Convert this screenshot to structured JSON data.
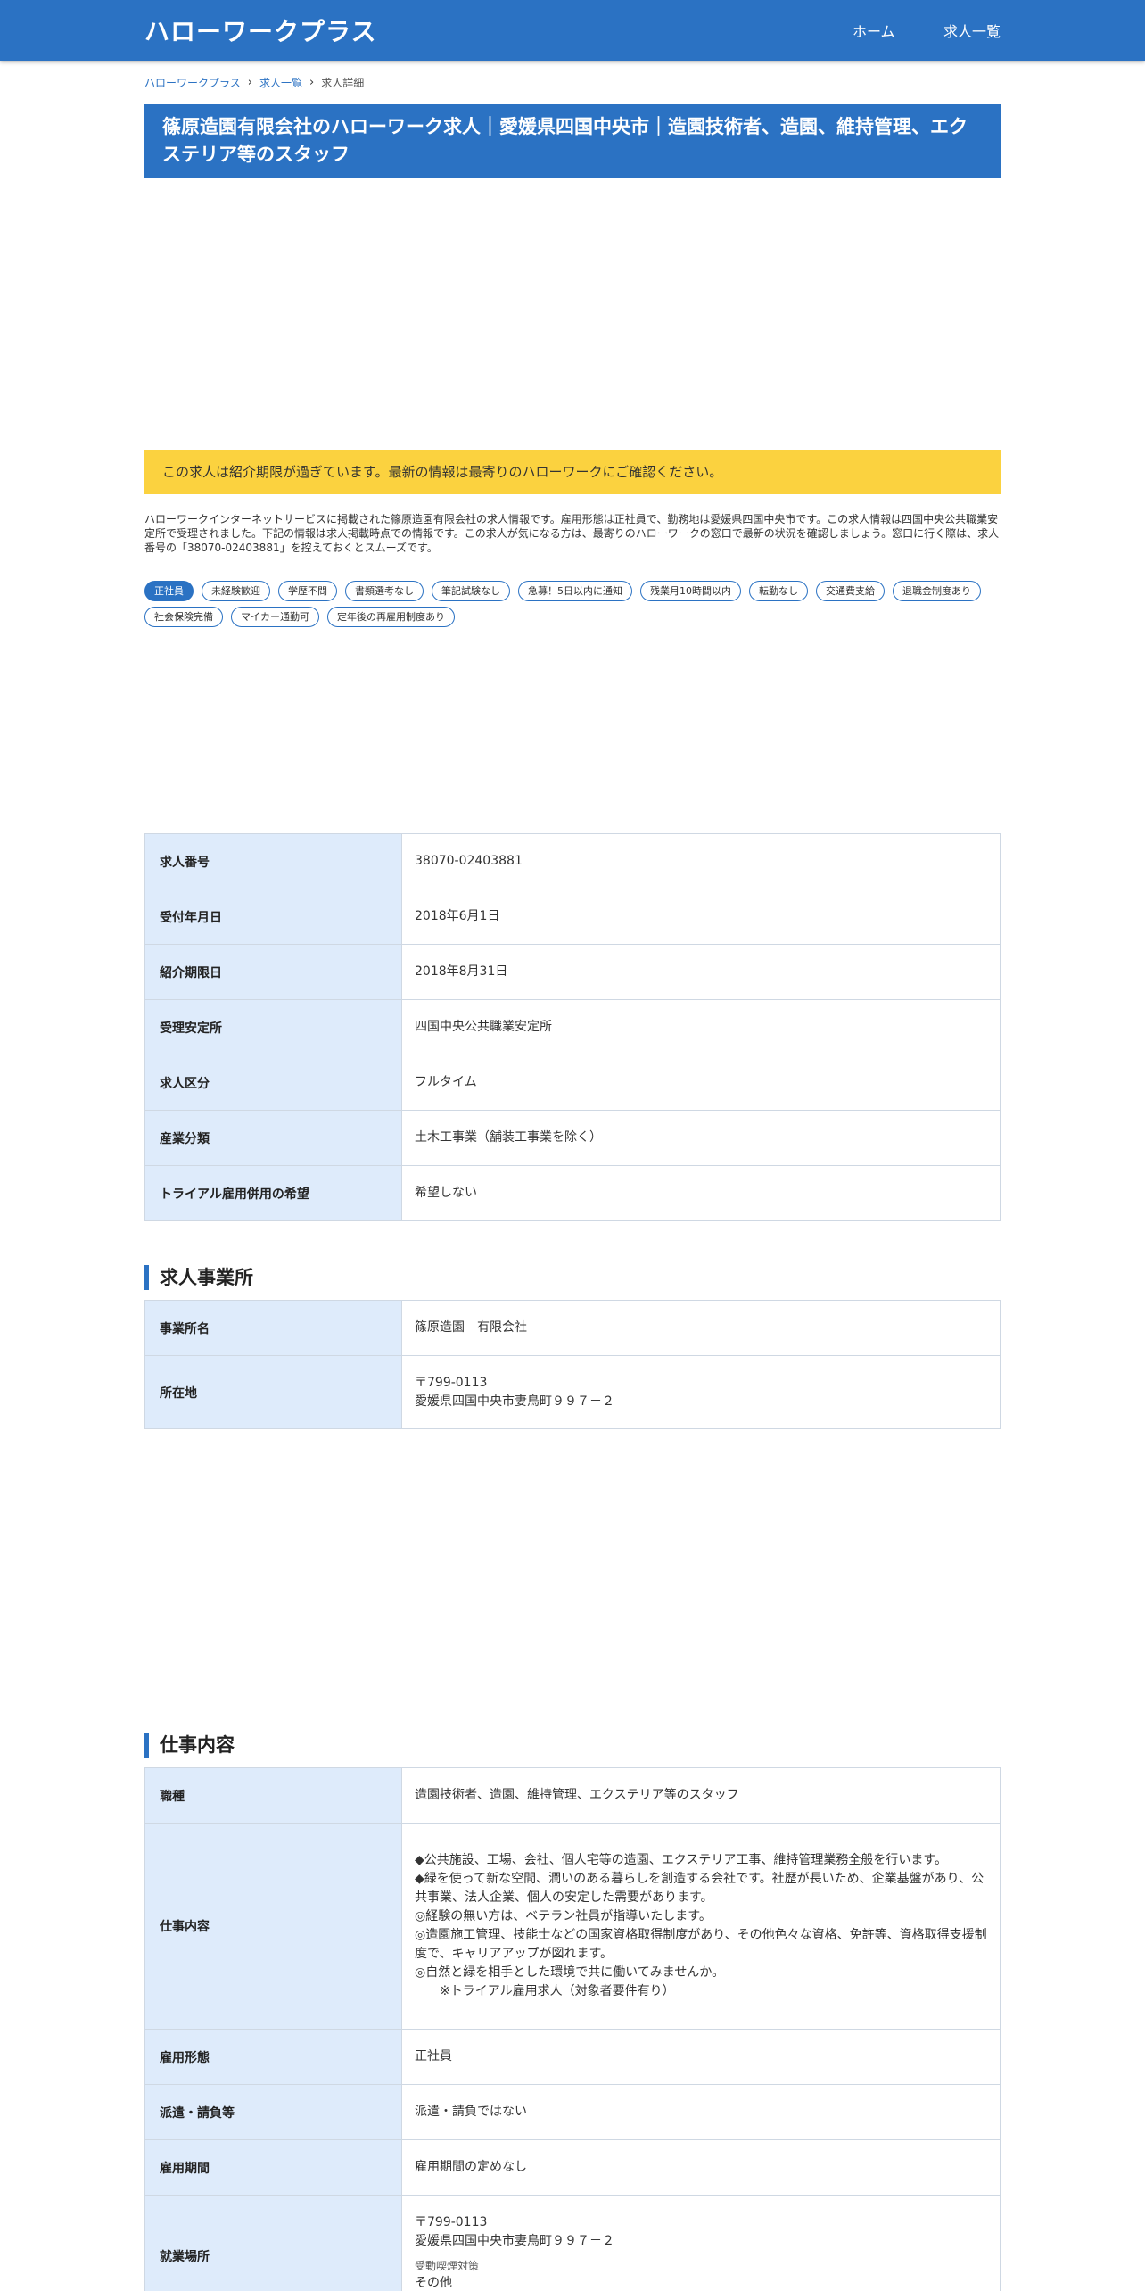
{
  "header": {
    "brand": "ハローワークプラス",
    "nav": {
      "home": "ホーム",
      "jobs": "求人一覧"
    }
  },
  "breadcrumb": {
    "items": [
      "ハローワークプラス",
      "求人一覧",
      "求人詳細"
    ]
  },
  "page_title": "篠原造園有限会社のハローワーク求人｜愛媛県四国中央市｜造園技術者、造園、維持管理、エクステリア等のスタッフ",
  "notice": "この求人は紹介期限が過ぎています。最新の情報は最寄りのハローワークにご確認ください。",
  "description": "ハローワークインターネットサービスに掲載された篠原造園有限会社の求人情報です。雇用形態は正社員で、勤務地は愛媛県四国中央市です。この求人情報は四国中央公共職業安定所で受理されました。下記の情報は求人掲載時点での情報です。この求人が気になる方は、最寄りのハローワークの窓口で最新の状況を確認しましょう。窓口に行く際は、求人番号の「38070-02403881」を控えておくとスムーズです。",
  "tags": [
    "正社員",
    "未経験歓迎",
    "学歴不問",
    "書類選考なし",
    "筆記試験なし",
    "急募！5日以内に通知",
    "残業月10時間以内",
    "転勤なし",
    "交通費支給",
    "退職金制度あり",
    "社会保険完備",
    "マイカー通勤可",
    "定年後の再雇用制度あり"
  ],
  "basic_info": [
    {
      "label": "求人番号",
      "value": "38070-02403881"
    },
    {
      "label": "受付年月日",
      "value": "2018年6月1日"
    },
    {
      "label": "紹介期限日",
      "value": "2018年8月31日"
    },
    {
      "label": "受理安定所",
      "value": "四国中央公共職業安定所"
    },
    {
      "label": "求人区分",
      "value": "フルタイム"
    },
    {
      "label": "産業分類",
      "value": "土木工事業（舗装工事業を除く）"
    },
    {
      "label": "トライアル雇用併用の希望",
      "value": "希望しない"
    }
  ],
  "office_section": {
    "title": "求人事業所",
    "name_label": "事業所名",
    "name_value": "篠原造園　有限会社",
    "address_label": "所在地",
    "postal": "〒799-0113",
    "address": "愛媛県四国中央市妻鳥町９９７－２"
  },
  "work_section": {
    "title": "仕事内容",
    "job_type_label": "職種",
    "job_type_value": "造園技術者、造園、維持管理、エクステリア等のスタッフ",
    "content_label": "仕事内容",
    "content_lines": [
      "◆公共施設、工場、会社、個人宅等の造園、エクステリア工事、維持管理業務全般を行います。",
      "◆緑を使って新な空間、潤いのある暮らしを創造する会社です。社歴が長いため、企業基盤があり、公共事業、法人企業、個人の安定した需要があります。",
      "◎経験の無い方は、ベテラン社員が指導いたします。",
      "◎造園施工管理、技能士などの国家資格取得制度があり、その他色々な資格、免許等、資格取得支援制度で、キャリアアップが図れます。",
      "◎自然と緑を相手とした環境で共に働いてみませんか。",
      "※トライアル雇用求人（対象者要件有り）"
    ],
    "employment_label": "雇用形態",
    "employment_value": "正社員",
    "dispatch_label": "派遣・請負等",
    "dispatch_value": "派遣・請負ではない",
    "period_label": "雇用期間",
    "period_value": "雇用期間の定めなし",
    "location_label": "就業場所",
    "location_postal": "〒799-0113",
    "location_address": "愛媛県四国中央市妻鳥町９９７－２",
    "smoking_label": "受動喫煙対策",
    "smoking_value": "その他"
  },
  "colors": {
    "primary": "#2b72c3",
    "notice": "#fbd23f",
    "label_bg": "#deebfb"
  }
}
